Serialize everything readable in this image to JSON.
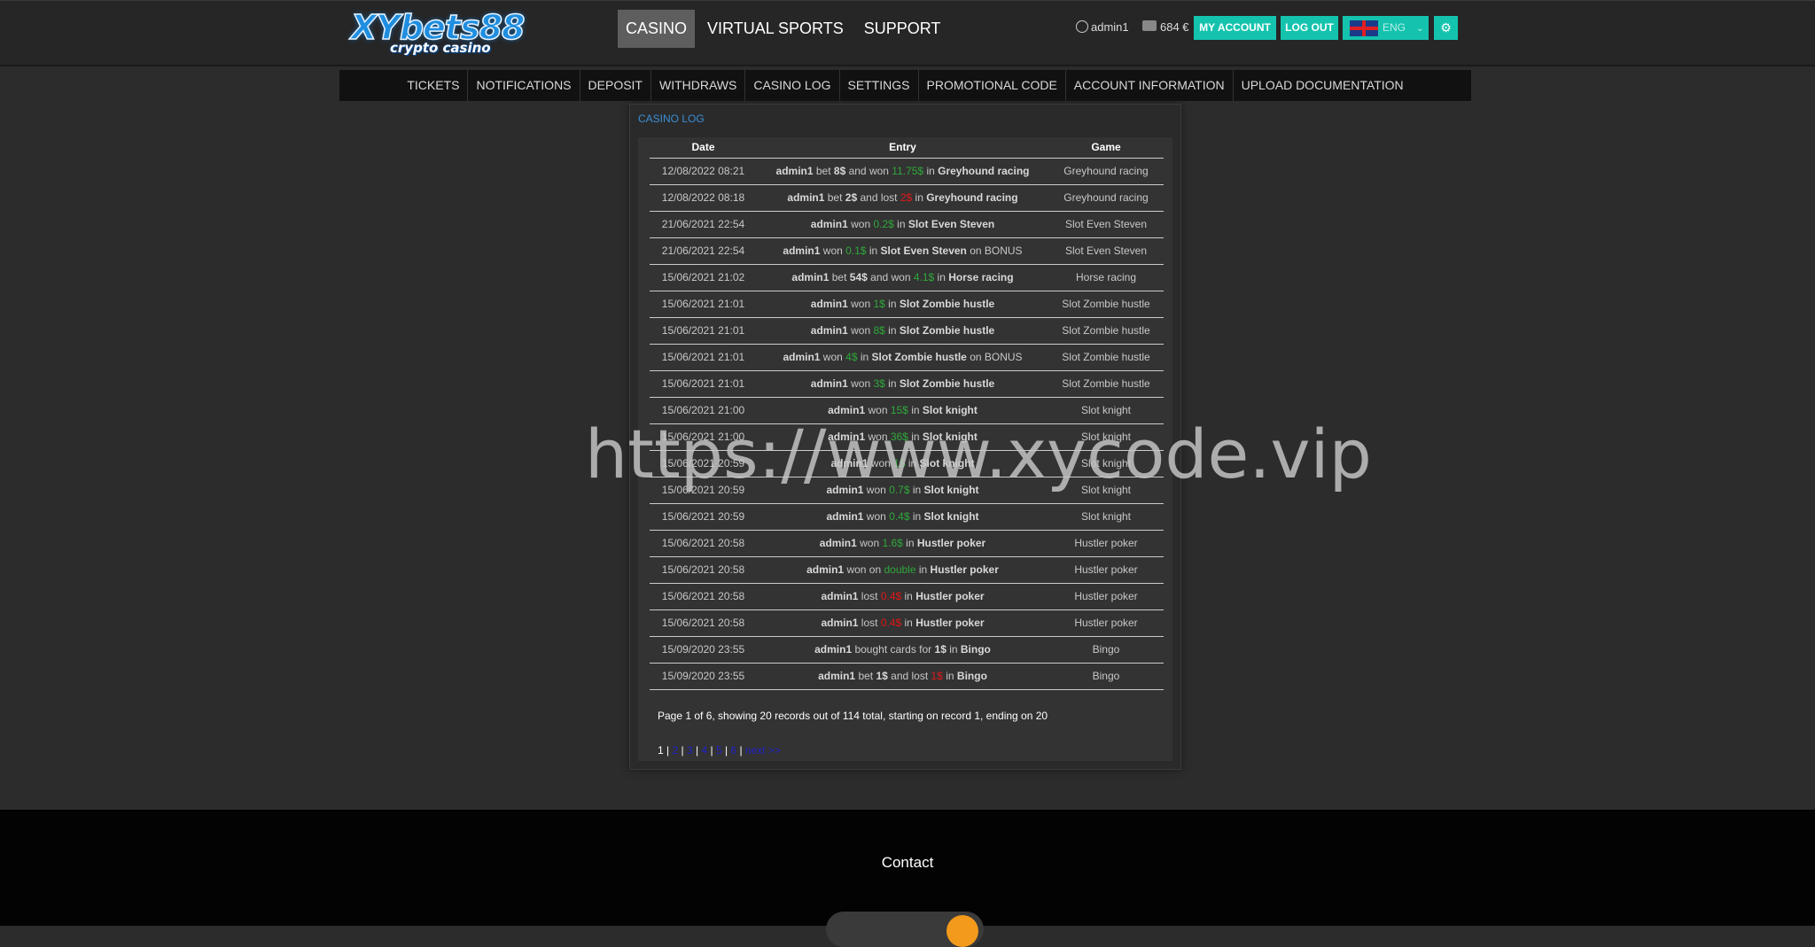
{
  "logo": {
    "line1": "XYbets88",
    "line2": "crypto casino"
  },
  "mainnav": [
    "CASINO",
    "VIRTUAL SPORTS",
    "SUPPORT"
  ],
  "user": {
    "name": "admin1",
    "balance": "684 €"
  },
  "buttons": {
    "my_account": "MY ACCOUNT",
    "logout": "LOG OUT",
    "language": "ENG"
  },
  "subnav": [
    "TICKETS",
    "NOTIFICATIONS",
    "DEPOSIT",
    "WITHDRAWS",
    "CASINO LOG",
    "SETTINGS",
    "PROMOTIONAL CODE",
    "ACCOUNT INFORMATION",
    "UPLOAD DOCUMENTATION"
  ],
  "log": {
    "title": "CASINO LOG",
    "headers": {
      "date": "Date",
      "entry": "Entry",
      "game": "Game"
    },
    "rows": [
      {
        "date": "12/08/2022 08:21",
        "game": "Greyhound racing",
        "entry": [
          [
            "b",
            "admin1"
          ],
          [
            "n",
            " bet "
          ],
          [
            "b",
            "8$"
          ],
          [
            "n",
            " and won "
          ],
          [
            "g",
            "11.75$"
          ],
          [
            "n",
            " in "
          ],
          [
            "b",
            "Greyhound racing"
          ]
        ]
      },
      {
        "date": "12/08/2022 08:18",
        "game": "Greyhound racing",
        "entry": [
          [
            "b",
            "admin1"
          ],
          [
            "n",
            " bet "
          ],
          [
            "b",
            "2$"
          ],
          [
            "n",
            " and lost "
          ],
          [
            "r",
            "2$"
          ],
          [
            "n",
            " in "
          ],
          [
            "b",
            "Greyhound racing"
          ]
        ]
      },
      {
        "date": "21/06/2021 22:54",
        "game": "Slot Even Steven",
        "entry": [
          [
            "b",
            "admin1"
          ],
          [
            "n",
            " won "
          ],
          [
            "g",
            "0.2$"
          ],
          [
            "n",
            " in "
          ],
          [
            "b",
            "Slot Even Steven"
          ]
        ]
      },
      {
        "date": "21/06/2021 22:54",
        "game": "Slot Even Steven",
        "entry": [
          [
            "b",
            "admin1"
          ],
          [
            "n",
            " won "
          ],
          [
            "g",
            "0.1$"
          ],
          [
            "n",
            " in "
          ],
          [
            "b",
            "Slot Even Steven"
          ],
          [
            "n",
            " on BONUS"
          ]
        ]
      },
      {
        "date": "15/06/2021 21:02",
        "game": "Horse racing",
        "entry": [
          [
            "b",
            "admin1"
          ],
          [
            "n",
            " bet "
          ],
          [
            "b",
            "54$"
          ],
          [
            "n",
            " and won "
          ],
          [
            "g",
            "4.1$"
          ],
          [
            "n",
            " in "
          ],
          [
            "b",
            "Horse racing"
          ]
        ]
      },
      {
        "date": "15/06/2021 21:01",
        "game": "Slot Zombie hustle",
        "entry": [
          [
            "b",
            "admin1"
          ],
          [
            "n",
            " won "
          ],
          [
            "g",
            "1$"
          ],
          [
            "n",
            " in "
          ],
          [
            "b",
            "Slot Zombie hustle"
          ]
        ]
      },
      {
        "date": "15/06/2021 21:01",
        "game": "Slot Zombie hustle",
        "entry": [
          [
            "b",
            "admin1"
          ],
          [
            "n",
            " won "
          ],
          [
            "g",
            "8$"
          ],
          [
            "n",
            " in "
          ],
          [
            "b",
            "Slot Zombie hustle"
          ]
        ]
      },
      {
        "date": "15/06/2021 21:01",
        "game": "Slot Zombie hustle",
        "entry": [
          [
            "b",
            "admin1"
          ],
          [
            "n",
            " won "
          ],
          [
            "g",
            "4$"
          ],
          [
            "n",
            " in "
          ],
          [
            "b",
            "Slot Zombie hustle"
          ],
          [
            "n",
            " on BONUS"
          ]
        ]
      },
      {
        "date": "15/06/2021 21:01",
        "game": "Slot Zombie hustle",
        "entry": [
          [
            "b",
            "admin1"
          ],
          [
            "n",
            " won "
          ],
          [
            "g",
            "3$"
          ],
          [
            "n",
            " in "
          ],
          [
            "b",
            "Slot Zombie hustle"
          ]
        ]
      },
      {
        "date": "15/06/2021 21:00",
        "game": "Slot knight",
        "entry": [
          [
            "b",
            "admin1"
          ],
          [
            "n",
            " won "
          ],
          [
            "g",
            "15$"
          ],
          [
            "n",
            " in "
          ],
          [
            "b",
            "Slot knight"
          ]
        ]
      },
      {
        "date": "15/06/2021 21:00",
        "game": "Slot knight",
        "entry": [
          [
            "b",
            "admin1"
          ],
          [
            "n",
            " won "
          ],
          [
            "g",
            "36$"
          ],
          [
            "n",
            " in "
          ],
          [
            "b",
            "Slot knight"
          ]
        ]
      },
      {
        "date": "15/06/2021 20:59",
        "game": "Slot knight",
        "entry": [
          [
            "b",
            "admin1"
          ],
          [
            "n",
            " won "
          ],
          [
            "g",
            "1$"
          ],
          [
            "n",
            " in "
          ],
          [
            "b",
            "Slot knight"
          ]
        ]
      },
      {
        "date": "15/06/2021 20:59",
        "game": "Slot knight",
        "entry": [
          [
            "b",
            "admin1"
          ],
          [
            "n",
            " won "
          ],
          [
            "g",
            "0.7$"
          ],
          [
            "n",
            " in "
          ],
          [
            "b",
            "Slot knight"
          ]
        ]
      },
      {
        "date": "15/06/2021 20:59",
        "game": "Slot knight",
        "entry": [
          [
            "b",
            "admin1"
          ],
          [
            "n",
            " won "
          ],
          [
            "g",
            "0.4$"
          ],
          [
            "n",
            " in "
          ],
          [
            "b",
            "Slot knight"
          ]
        ]
      },
      {
        "date": "15/06/2021 20:58",
        "game": "Hustler poker",
        "entry": [
          [
            "b",
            "admin1"
          ],
          [
            "n",
            " won "
          ],
          [
            "g",
            "1.6$"
          ],
          [
            "n",
            " in "
          ],
          [
            "b",
            "Hustler poker"
          ]
        ]
      },
      {
        "date": "15/06/2021 20:58",
        "game": "Hustler poker",
        "entry": [
          [
            "b",
            "admin1"
          ],
          [
            "n",
            " won on "
          ],
          [
            "g",
            "double"
          ],
          [
            "n",
            " in "
          ],
          [
            "b",
            "Hustler poker"
          ]
        ]
      },
      {
        "date": "15/06/2021 20:58",
        "game": "Hustler poker",
        "entry": [
          [
            "b",
            "admin1"
          ],
          [
            "n",
            " lost "
          ],
          [
            "r",
            "0.4$"
          ],
          [
            "n",
            " in "
          ],
          [
            "b",
            "Hustler poker"
          ]
        ]
      },
      {
        "date": "15/06/2021 20:58",
        "game": "Hustler poker",
        "entry": [
          [
            "b",
            "admin1"
          ],
          [
            "n",
            " lost "
          ],
          [
            "r",
            "0.4$"
          ],
          [
            "n",
            " in "
          ],
          [
            "b",
            "Hustler poker"
          ]
        ]
      },
      {
        "date": "15/09/2020 23:55",
        "game": "Bingo",
        "entry": [
          [
            "b",
            "admin1"
          ],
          [
            "n",
            " bought cards for "
          ],
          [
            "b",
            "1$"
          ],
          [
            "n",
            " in "
          ],
          [
            "b",
            "Bingo"
          ]
        ]
      },
      {
        "date": "15/09/2020 23:55",
        "game": "Bingo",
        "entry": [
          [
            "b",
            "admin1"
          ],
          [
            "n",
            " bet "
          ],
          [
            "b",
            "1$"
          ],
          [
            "n",
            " and lost "
          ],
          [
            "r",
            "1$"
          ],
          [
            "n",
            " in "
          ],
          [
            "b",
            "Bingo"
          ]
        ]
      }
    ],
    "page_info": "Page 1 of 6, showing 20 records out of 114 total, starting on record 1, ending on 20",
    "pager": {
      "current": "1",
      "links": [
        "2",
        "3",
        "4",
        "5",
        "6"
      ],
      "next": "next >>"
    }
  },
  "watermark": "https://www.xycode.vip",
  "footer": {
    "contact": "Contact"
  }
}
